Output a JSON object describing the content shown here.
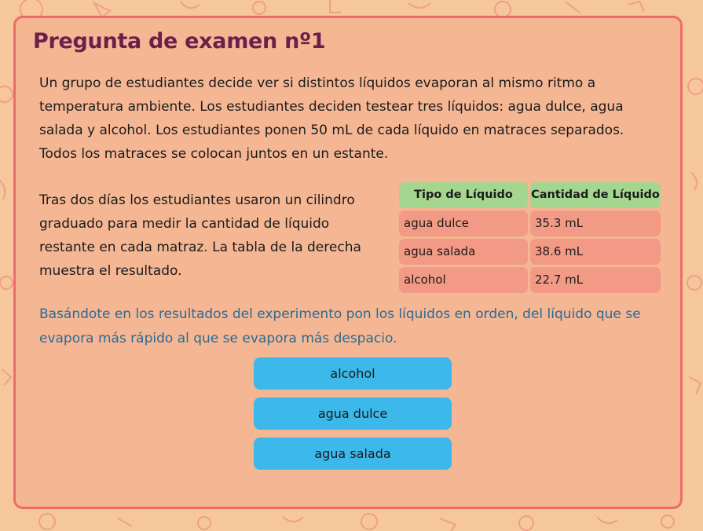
{
  "colors": {
    "page_background": "#f6c79b",
    "card_background": "#f4b693",
    "card_border": "#ee6b6b",
    "title": "#6b1f4a",
    "question_text": "#2a6b94",
    "table_header": "#a5d68f",
    "table_cell": "#f29a85",
    "answer_button": "#3db8ea"
  },
  "title": "Pregunta de examen nº1",
  "intro": "Un grupo de estudiantes decide ver si distintos líquidos evaporan al mismo ritmo a temperatura ambiente. Los estudiantes deciden testear tres líquidos: agua dulce, agua salada y alcohol. Los estudiantes ponen 50 mL de cada líquido en matraces separados. Todos los matraces se colocan juntos en un estante.",
  "paragraph": "Tras dos días los estudiantes usaron un cilindro graduado para medir la cantidad de líquido restante en cada matraz. La tabla de la derecha muestra el resultado.",
  "table": {
    "headers": [
      "Tipo de Líquido",
      "Cantidad de Líquido"
    ],
    "rows": [
      [
        "agua dulce",
        "35.3 mL"
      ],
      [
        "agua salada",
        "38.6 mL"
      ],
      [
        "alcohol",
        "22.7 mL"
      ]
    ]
  },
  "question": "Basándote en los resultados del experimento pon los líquidos en orden, del líquido que se evapora más rápido al que se evapora más despacio.",
  "answers": [
    "alcohol",
    "agua dulce",
    "agua salada"
  ]
}
